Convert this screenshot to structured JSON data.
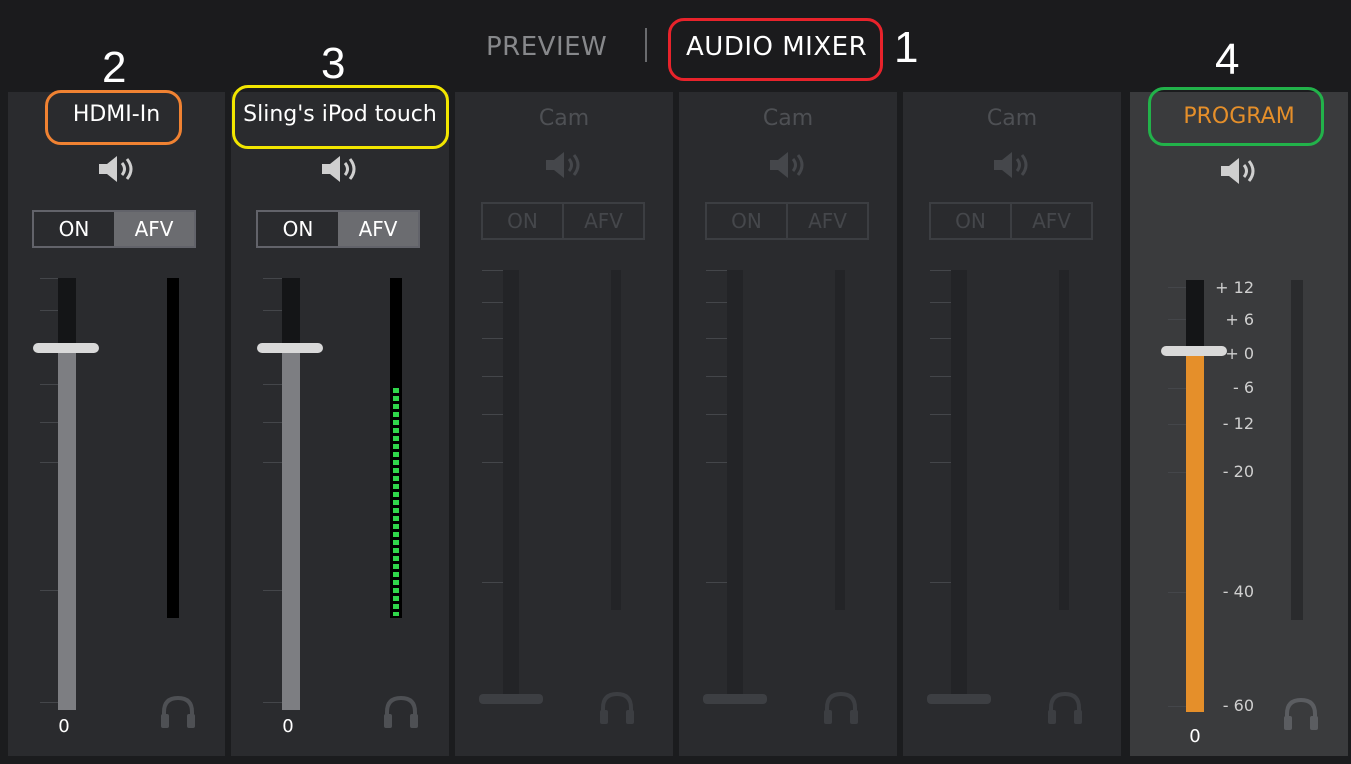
{
  "tabs": [
    {
      "label": "PREVIEW"
    },
    {
      "label": "AUDIO MIXER"
    }
  ],
  "annotations": [
    "1",
    "2",
    "3",
    "4"
  ],
  "channels": [
    {
      "name": "HDMI-In",
      "on_label": "ON",
      "afv_label": "AFV",
      "afv_active": true,
      "fader_level": "0",
      "meter_fill": 0
    },
    {
      "name": "Sling's iPod touch",
      "on_label": "ON",
      "afv_label": "AFV",
      "afv_active": true,
      "fader_level": "0",
      "meter_fill": 0.68
    },
    {
      "name": "Cam",
      "on_label": "ON",
      "afv_label": "AFV"
    },
    {
      "name": "Cam",
      "on_label": "ON",
      "afv_label": "AFV"
    },
    {
      "name": "Cam",
      "on_label": "ON",
      "afv_label": "AFV"
    }
  ],
  "program": {
    "name": "PROGRAM",
    "fader_level": "0",
    "scale": [
      "+ 12",
      "+ 6",
      "+ 0",
      "- 6",
      "- 12",
      "- 20",
      "- 40",
      "- 60"
    ]
  },
  "colors": {
    "program_accent": "#e58f2a",
    "meter_green": "#2fd64a",
    "annotation_mixer": "#e8232b",
    "annotation_hdmi": "#f08232",
    "annotation_ipod": "#f2e600",
    "annotation_program": "#22b24a"
  },
  "icons": [
    "speaker-icon",
    "headphones-icon"
  ]
}
